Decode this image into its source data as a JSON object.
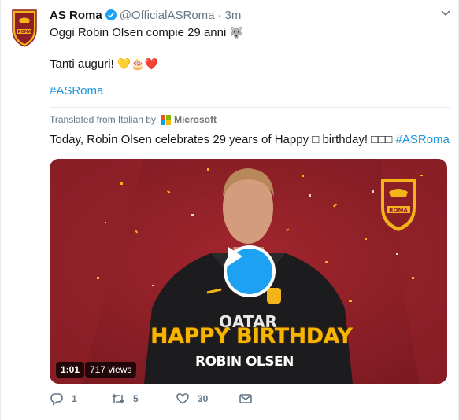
{
  "tweet": {
    "author_name": "AS Roma",
    "handle": "@OfficialASRoma",
    "separator": "·",
    "time": "3m",
    "line1": "Oggi Robin Olsen compie 29 anni",
    "line1_emoji": "🐺",
    "line2": "Tanti auguri!",
    "line2_emoji": "💛🎂❤️",
    "hashtag": "#ASRoma"
  },
  "translation": {
    "label": "Translated from Italian by",
    "provider": "Microsoft",
    "text": "Today, Robin Olsen celebrates 29 years of Happy □ birthday! □□□",
    "hashtag": "#ASRoma"
  },
  "media": {
    "headline": "HAPPY BIRTHDAY",
    "player_name": "ROBIN OLSEN",
    "shirt_sponsor": "QATAR",
    "badge_text": "ROMA",
    "duration": "1:01",
    "views": "717 views"
  },
  "actions": {
    "replies": "1",
    "retweets": "5",
    "likes": "30"
  },
  "colors": {
    "link": "#1b95e0",
    "accent": "#1da1f2",
    "muted": "#657786",
    "roma_red": "#8c1f26",
    "roma_gold": "#f7b500"
  }
}
